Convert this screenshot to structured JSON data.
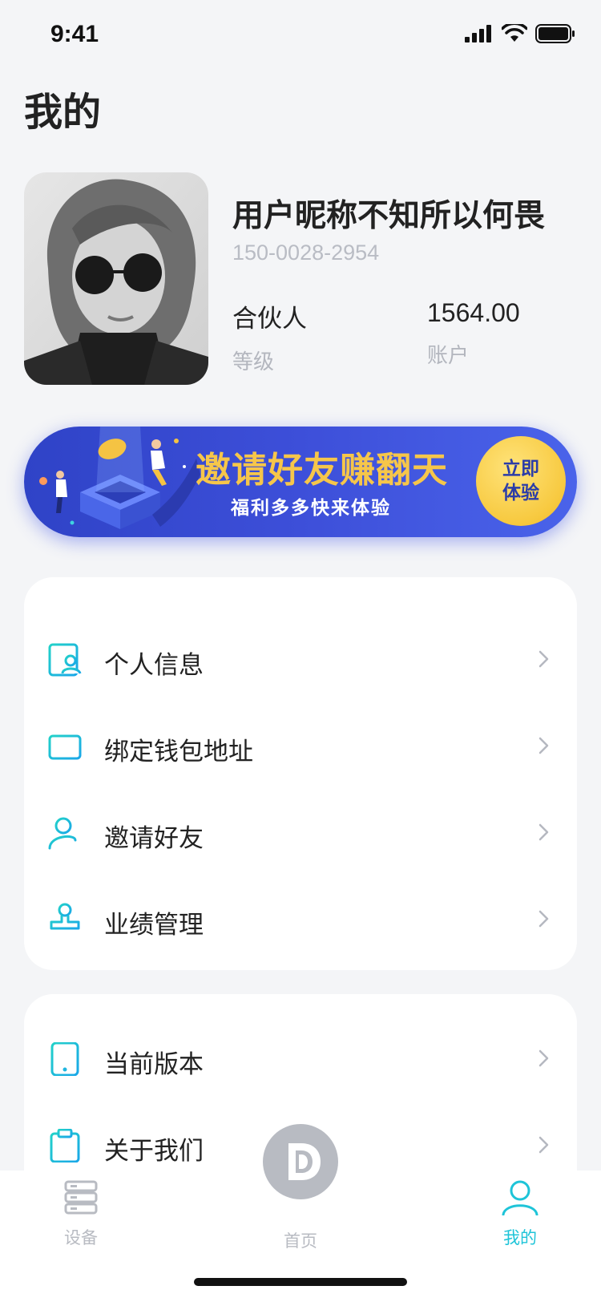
{
  "status_bar": {
    "time": "9:41"
  },
  "page": {
    "title": "我的"
  },
  "profile": {
    "nickname": "用户昵称不知所以何畏",
    "phone": "150-0028-2954",
    "level_value": "合伙人",
    "level_label": "等级",
    "account_value": "1564.00",
    "account_label": "账户"
  },
  "banner": {
    "title": "邀请好友赚翻天",
    "subtitle": "福利多多快来体验",
    "cta_line1": "立即",
    "cta_line2": "体验"
  },
  "menu_group_1": [
    {
      "label": "个人信息",
      "icon": "profile-card-icon"
    },
    {
      "label": "绑定钱包地址",
      "icon": "wallet-card-icon"
    },
    {
      "label": "邀请好友",
      "icon": "add-user-icon"
    },
    {
      "label": "业绩管理",
      "icon": "stamp-icon"
    }
  ],
  "menu_group_2": [
    {
      "label": "当前版本",
      "icon": "phone-device-icon"
    },
    {
      "label": "关于我们",
      "icon": "clipboard-icon"
    }
  ],
  "tab_bar": {
    "devices": "设备",
    "home": "首页",
    "mine": "我的"
  },
  "colors": {
    "accent": "#1ec4d8",
    "banner_bg": "#3a4cd6",
    "banner_title": "#f6c64a",
    "inactive": "#b8bbc2"
  }
}
